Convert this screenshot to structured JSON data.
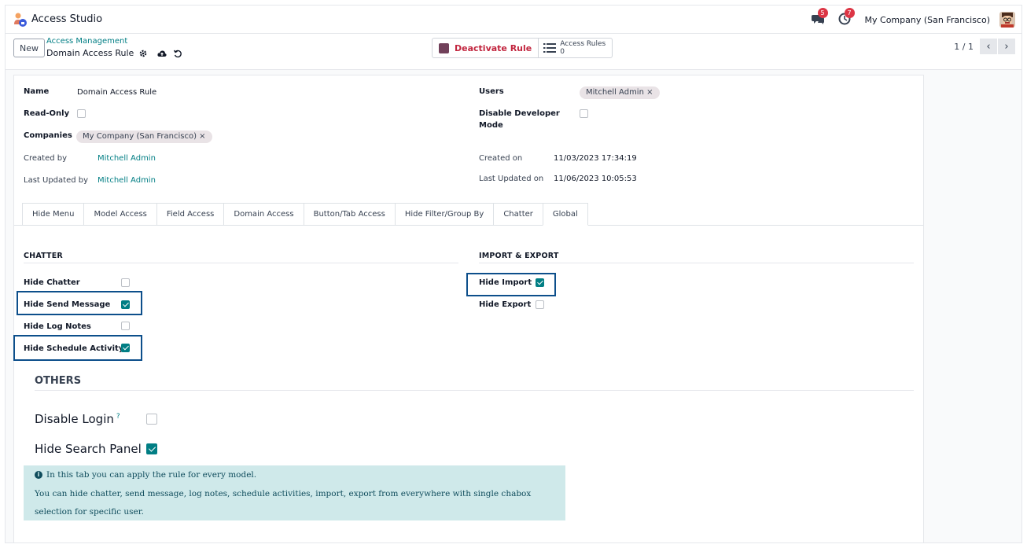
{
  "app": {
    "name": "Access Studio"
  },
  "systray": {
    "messages_count": "5",
    "activities_count": "7",
    "company": "My Company (San Francisco)"
  },
  "control": {
    "new_label": "New",
    "breadcrumb": "Access Management",
    "record_title": "Domain Access Rule",
    "deactivate_label": "Deactivate Rule",
    "access_rules_label": "Access Rules",
    "access_rules_count": "0",
    "pager": "1 / 1"
  },
  "form": {
    "name_label": "Name",
    "name_value": "Domain Access Rule",
    "readonly_label": "Read-Only",
    "readonly_checked": false,
    "companies_label": "Companies",
    "companies_tag": "My Company (San Francisco)",
    "created_by_label": "Created by",
    "created_by_value": "Mitchell Admin",
    "last_updated_by_label": "Last Updated by",
    "last_updated_by_value": "Mitchell Admin",
    "users_label": "Users",
    "users_tag": "Mitchell Admin",
    "disable_dev_label_1": "Disable Developer",
    "disable_dev_label_2": "Mode",
    "disable_dev_checked": false,
    "created_on_label": "Created on",
    "created_on_value": "11/03/2023 17:34:19",
    "last_updated_on_label": "Last Updated on",
    "last_updated_on_value": "11/06/2023 10:05:53"
  },
  "tabs": [
    "Hide Menu",
    "Model Access",
    "Field Access",
    "Domain Access",
    "Button/Tab Access",
    "Hide Filter/Group By",
    "Chatter",
    "Global"
  ],
  "active_tab": "Global",
  "chatter": {
    "title": "CHATTER",
    "items": [
      {
        "label": "Hide Chatter",
        "checked": false
      },
      {
        "label": "Hide Send Message",
        "checked": true
      },
      {
        "label": "Hide Log Notes",
        "checked": false
      },
      {
        "label": "Hide Schedule Activity",
        "checked": true
      }
    ]
  },
  "import_export": {
    "title": "IMPORT & EXPORT",
    "items": [
      {
        "label": "Hide Import",
        "checked": true
      },
      {
        "label": "Hide Export",
        "checked": false
      }
    ]
  },
  "others": {
    "title": "OTHERS",
    "disable_login_label": "Disable Login",
    "disable_login_help": "?",
    "disable_login_checked": false,
    "hide_search_panel_label": "Hide Search Panel",
    "hide_search_panel_checked": true
  },
  "info": {
    "line1": "In this tab you can apply the rule for every model.",
    "line2": "You can hide chatter, send message, log notes, schedule activities, import, export from everywhere with single chabox",
    "line3": "selection for specific user."
  },
  "colors": {
    "accent": "#017e84",
    "highlight_border": "#0d4f8b",
    "deactivate": "#c2263f",
    "badge": "#dc3545",
    "alert_bg": "#cfe9ea"
  }
}
